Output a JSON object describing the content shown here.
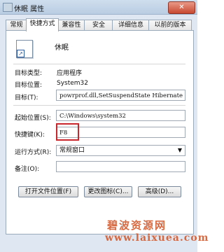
{
  "window": {
    "title": "休眠 属性",
    "close_label": "✕"
  },
  "tabs": [
    {
      "label": "常规",
      "active": false
    },
    {
      "label": "快捷方式",
      "active": true
    },
    {
      "label": "兼容性",
      "active": false
    },
    {
      "label": "安全",
      "active": false
    },
    {
      "label": "详细信息",
      "active": false
    },
    {
      "label": "以前的版本",
      "active": false
    }
  ],
  "shortcut": {
    "name": "休眠",
    "icon": "shortcut-arrow-icon",
    "target_type_label": "目标类型:",
    "target_type_value": "应用程序",
    "target_location_label": "目标位置:",
    "target_location_value": "System32",
    "target_label": "目标(T):",
    "target_value": "powrprof.dll,SetSuspendState Hibernate",
    "start_in_label": "起始位置(S):",
    "start_in_value": "C:\\Windows\\system32",
    "hotkey_label": "快捷键(K):",
    "hotkey_value": "F8",
    "run_label": "运行方式(R):",
    "run_value": "常规窗口",
    "comment_label": "备注(O):",
    "comment_value": ""
  },
  "buttons": {
    "open_location": "打开文件位置(F)",
    "change_icon": "更改图标(C)...",
    "advanced": "高级(D)..."
  },
  "watermark": {
    "text": "碧波资源网",
    "url": "www.laixuea.com"
  },
  "colors": {
    "highlight": "#c8262c",
    "watermark": "#d45a2e"
  }
}
